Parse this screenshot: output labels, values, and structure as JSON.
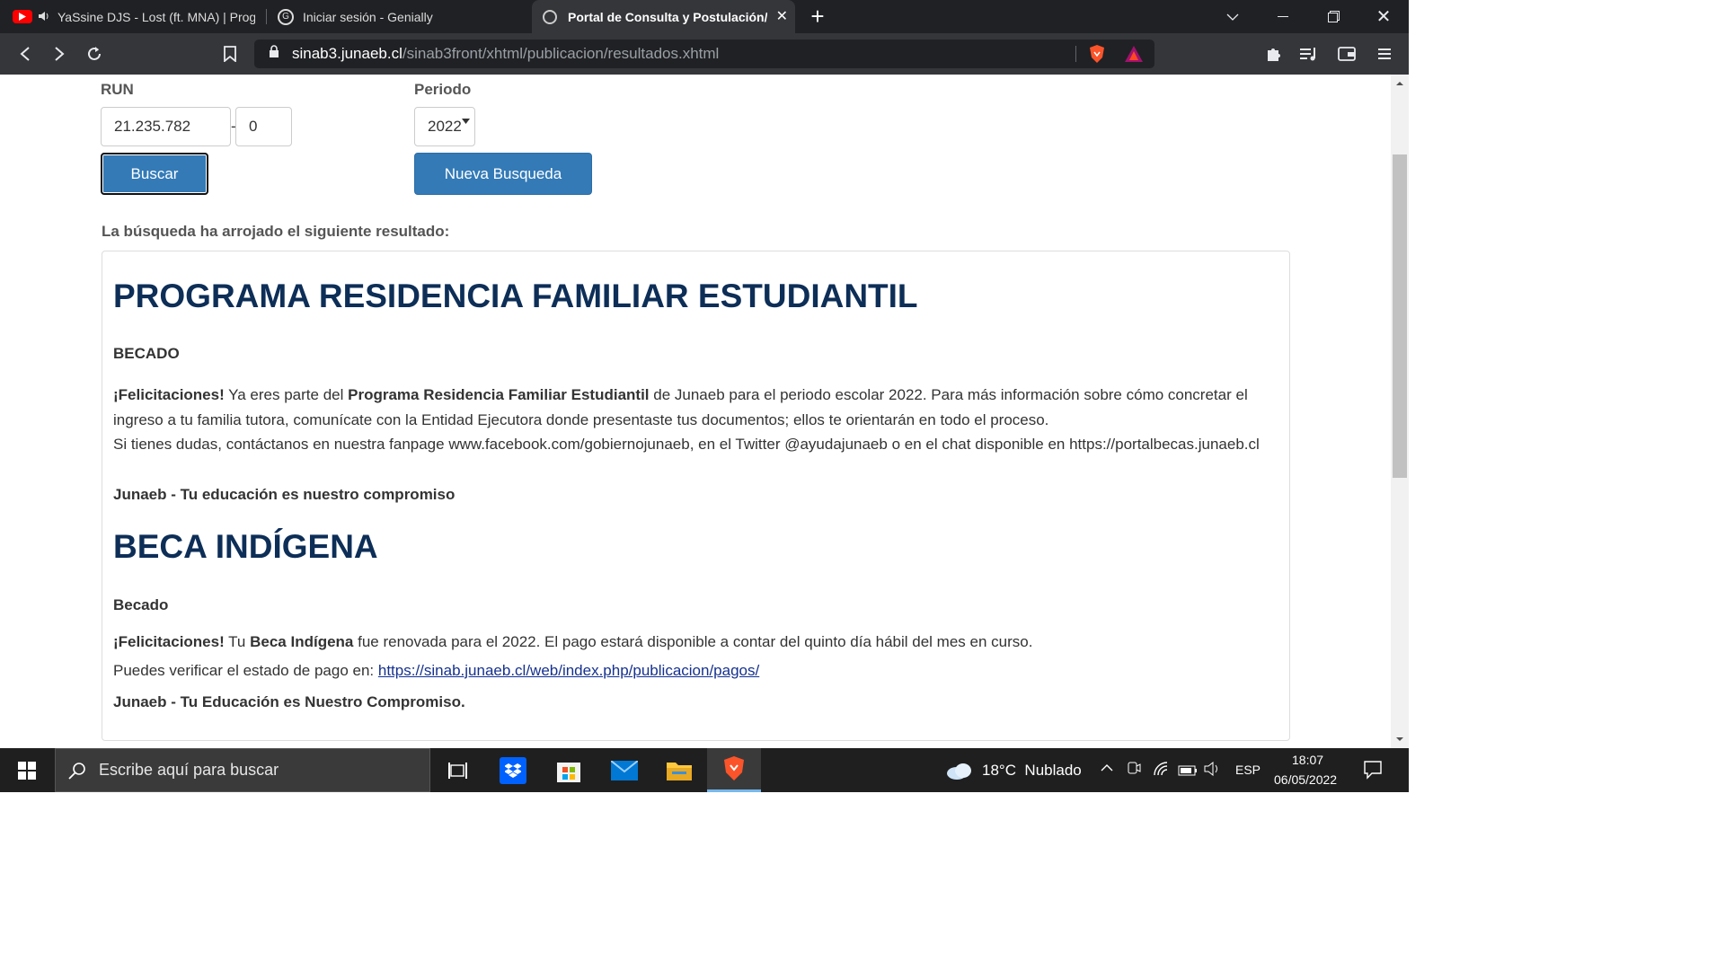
{
  "browser": {
    "tabs": [
      {
        "title": "YaSsine DJS - Lost (ft. MNA) | Prog",
        "active": false
      },
      {
        "title": "Iniciar sesión - Genially",
        "active": false
      },
      {
        "title": "Portal de Consulta y Postulación/",
        "active": true
      }
    ],
    "url_host": "sinab3.junaeb.cl",
    "url_path": "/sinab3front/xhtml/publicacion/resultados.xhtml"
  },
  "form": {
    "run_label": "RUN",
    "run_value": "21.235.782",
    "run_separator": "-",
    "dv_value": "0",
    "periodo_label": "Periodo",
    "periodo_value": "2022",
    "buscar_label": "Buscar",
    "nueva_label": "Nueva Busqueda"
  },
  "result": {
    "intro": "La búsqueda ha arrojado el siguiente resultado:",
    "programs": [
      {
        "title": "PROGRAMA RESIDENCIA FAMILIAR ESTUDIANTIL",
        "status": "BECADO",
        "congrats": "¡Felicitaciones!",
        "p1a": " Ya eres parte del ",
        "p1b": "Programa Residencia Familiar Estudiantil",
        "p1c": " de Junaeb para el periodo escolar 2022. Para más información sobre cómo concretar el",
        "p2": "ingreso a tu familia tutora, comunícate con la Entidad Ejecutora donde presentaste tus documentos; ellos te orientarán en todo el proceso.",
        "p3": "Si tienes dudas, contáctanos en nuestra fanpage www.facebook.com/gobiernojunaeb, en el Twitter @ayudajunaeb o en el chat disponible en https://portalbecas.junaeb.cl",
        "footer": "Junaeb - Tu educación es nuestro compromiso"
      },
      {
        "title": "BECA INDÍGENA",
        "status": "Becado",
        "congrats": "¡Felicitaciones!",
        "p1a": " Tu ",
        "p1b": "Beca Indígena",
        "p1c": " fue renovada para el 2022. El pago estará disponible a contar del quinto día hábil del mes en curso.",
        "p2": "Puedes verificar el estado de pago en: ",
        "link": "https://sinab.junaeb.cl/web/index.php/publicacion/pagos/",
        "footer": "Junaeb - Tu Educación es Nuestro Compromiso."
      }
    ]
  },
  "taskbar": {
    "search_placeholder": "Escribe aquí para buscar",
    "weather": "18°C  Nublado",
    "lang": "ESP",
    "time": "18:07",
    "date": "06/05/2022"
  },
  "colors": {
    "heading": "#0d2e57",
    "primary_button": "#337ab7",
    "link": "#15318f"
  }
}
